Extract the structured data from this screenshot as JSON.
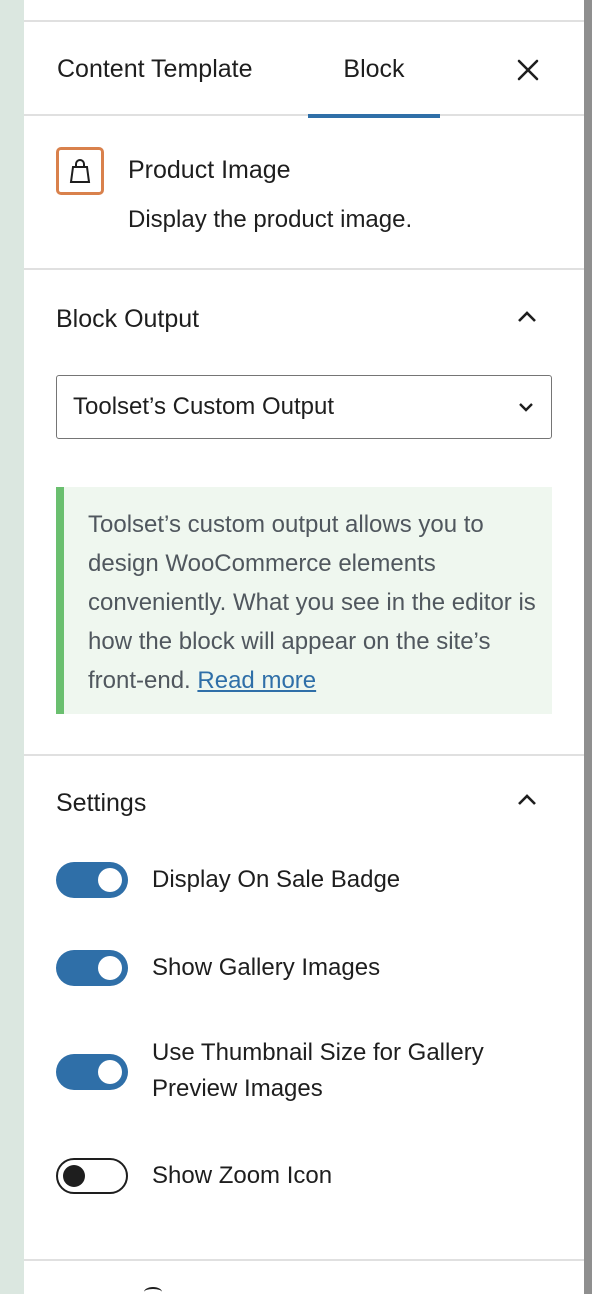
{
  "tabs": {
    "template_label": "Content Template",
    "block_label": "Block"
  },
  "block_card": {
    "title": "Product Image",
    "description": "Display the product image.",
    "accent": "#d9814c"
  },
  "block_output": {
    "title": "Block Output",
    "selected_option": "Toolset’s Custom Output",
    "notice_text": "Toolset’s custom output allows you to design WooCommerce elements conveniently. What you see in the editor is how the block will appear on the site’s front-end. ",
    "notice_link": "Read more"
  },
  "settings": {
    "title": "Settings",
    "toggles": [
      {
        "label": "Display On Sale Badge",
        "checked": true
      },
      {
        "label": "Show Gallery Images",
        "checked": true
      },
      {
        "label": "Use Thumbnail Size for Gallery Preview Images",
        "checked": true
      },
      {
        "label": "Show Zoom Icon",
        "checked": false
      }
    ]
  },
  "colors": {
    "primary": "#2f6fa8",
    "notice_border": "#6abf6f",
    "notice_bg": "#eff7ef"
  }
}
